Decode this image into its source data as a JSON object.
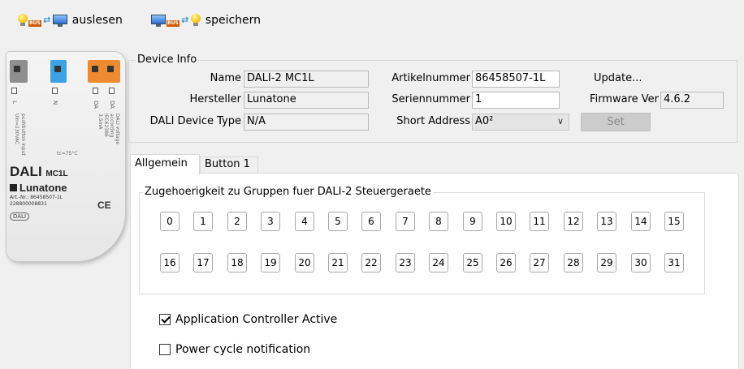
{
  "toolbar": {
    "read_label": "auslesen",
    "save_label": "speichern",
    "bus_badge": "BUS"
  },
  "device_image": {
    "pin_labels": [
      "L",
      "N",
      "DA",
      "DA"
    ],
    "text_lines": [
      "pushbutton input",
      "Uin=230VAC",
      "DALI voltage",
      "according",
      "IEC62386",
      "3,5mA"
    ],
    "temp": "tc=75°C",
    "model": "DALI",
    "model_suffix": "MC1L",
    "maker": "Lunatone",
    "art_nr": "Art.-Nr.: 86458507-1L",
    "serial": "228800008831",
    "ce": "CE",
    "logos": [
      "DALI"
    ]
  },
  "device_info": {
    "title": "Device Info",
    "name_label": "Name",
    "name_value": "DALI-2 MC1L",
    "manufacturer_label": "Hersteller",
    "manufacturer_value": "Lunatone",
    "device_type_label": "DALI Device Type",
    "device_type_value": "N/A",
    "article_label": "Artikelnummer",
    "article_value": "86458507-1L",
    "serial_label": "Seriennummer",
    "serial_value": "1",
    "short_address_label": "Short Address",
    "short_address_value": "A0²",
    "update_label": "Update...",
    "firmware_label": "Firmware Ver",
    "firmware_value": "4.6.2",
    "set_label": "Set"
  },
  "tabs": [
    {
      "label": "Allgemein",
      "active": true
    },
    {
      "label": "Button 1",
      "active": false
    }
  ],
  "groups": {
    "title": "Zugehoerigkeit zu Gruppen fuer DALI-2 Steuergeraete",
    "row1": [
      "0",
      "1",
      "2",
      "3",
      "4",
      "5",
      "6",
      "7",
      "8",
      "9",
      "10",
      "11",
      "12",
      "13",
      "14",
      "15"
    ],
    "row2": [
      "16",
      "17",
      "18",
      "19",
      "20",
      "21",
      "22",
      "23",
      "24",
      "25",
      "26",
      "27",
      "28",
      "29",
      "30",
      "31"
    ]
  },
  "options": {
    "app_controller_label": "Application Controller Active",
    "app_controller_checked": true,
    "power_cycle_label": "Power cycle notification",
    "power_cycle_checked": false
  }
}
